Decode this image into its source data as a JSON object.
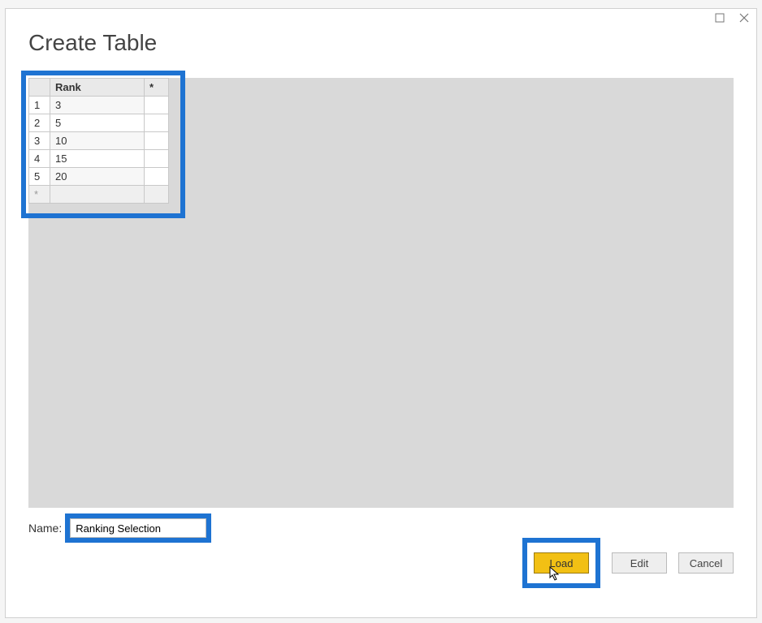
{
  "dialog": {
    "title": "Create Table"
  },
  "table": {
    "column_header": "Rank",
    "star_header": "*",
    "rows": [
      {
        "num": "1",
        "value": "3"
      },
      {
        "num": "2",
        "value": "5"
      },
      {
        "num": "3",
        "value": "10"
      },
      {
        "num": "4",
        "value": "15"
      },
      {
        "num": "5",
        "value": "20"
      }
    ],
    "new_row_marker": "*"
  },
  "name_field": {
    "label": "Name:",
    "value": "Ranking Selection"
  },
  "buttons": {
    "load": "Load",
    "edit": "Edit",
    "cancel": "Cancel"
  }
}
